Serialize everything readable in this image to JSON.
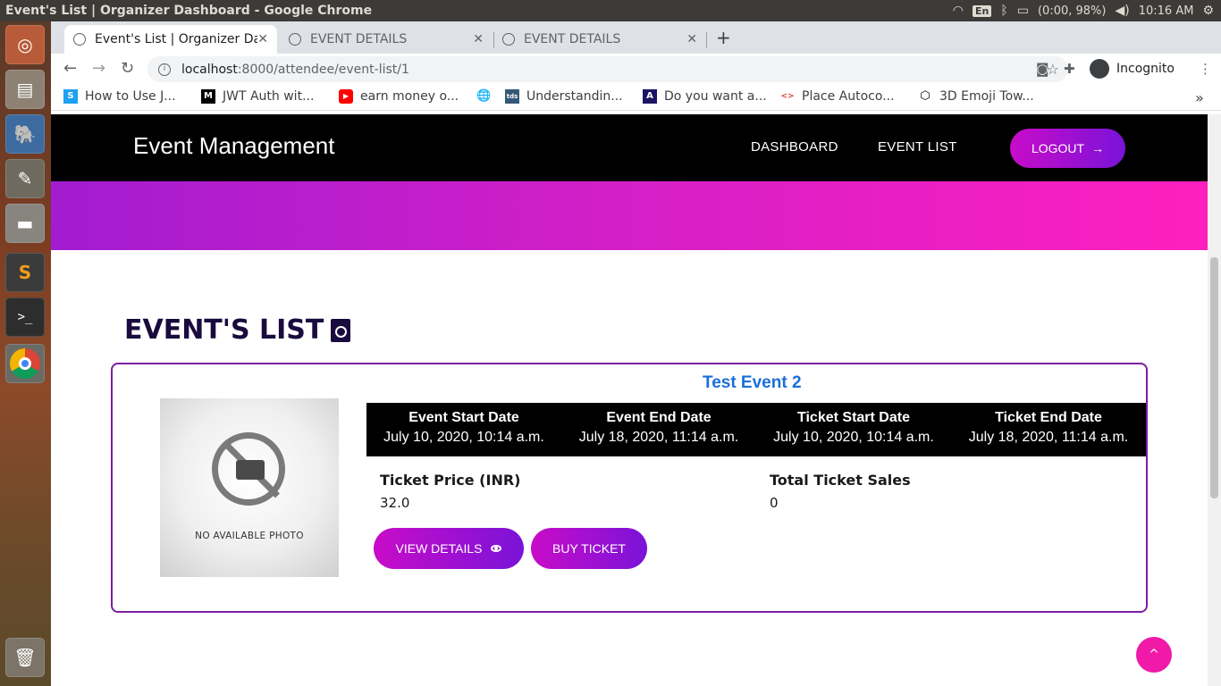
{
  "os": {
    "window_title": "Event's List | Organizer Dashboard - Google Chrome",
    "keyboard": "En",
    "battery": "(0:00, 98%)",
    "clock": "10:16 AM"
  },
  "browser": {
    "tabs": [
      {
        "label": "Event's List | Organizer Da",
        "close": "✕"
      },
      {
        "label": "EVENT DETAILS",
        "close": "✕"
      },
      {
        "label": "EVENT DETAILS",
        "close": "✕"
      }
    ],
    "new_tab": "+",
    "url_host": "localhost",
    "url_path": ":8000/attendee/event-list/1",
    "incognito_label": "Incognito",
    "bookmarks": [
      {
        "label": "How to Use J...",
        "icon": "S"
      },
      {
        "label": "JWT Auth wit...",
        "icon": "M"
      },
      {
        "label": "earn money o...",
        "icon": "▶"
      },
      {
        "label": "",
        "icon": "🌐"
      },
      {
        "label": "Understandin...",
        "icon": "tds"
      },
      {
        "label": "Do you want a...",
        "icon": "A"
      },
      {
        "label": "Place Autoco...",
        "icon": "<>"
      },
      {
        "label": "3D Emoji Tow...",
        "icon": "⬡"
      }
    ],
    "bookmarks_more": "»"
  },
  "site": {
    "brand": "Event Management",
    "nav": {
      "dashboard": "DASHBOARD",
      "event_list": "EVENT LIST"
    },
    "logout": "LOGOUT",
    "logout_arrow": "→"
  },
  "main": {
    "title": "EVENT'S LIST",
    "events": [
      {
        "name": "Test Event 2",
        "photo_text": "NO AVAILABLE PHOTO",
        "dates": [
          {
            "header": "Event Start Date",
            "value": "July 10, 2020, 10:14 a.m."
          },
          {
            "header": "Event End Date",
            "value": "July 18, 2020, 11:14 a.m."
          },
          {
            "header": "Ticket Start Date",
            "value": "July 10, 2020, 10:14 a.m."
          },
          {
            "header": "Ticket End Date",
            "value": "July 18, 2020, 11:14 a.m."
          }
        ],
        "ticket_price_label": "Ticket Price (INR)",
        "ticket_price": "32.0",
        "sales_label": "Total Ticket Sales",
        "sales": "0",
        "view_details": "VIEW DETAILS",
        "buy_ticket": "BUY TICKET"
      }
    ],
    "back_to_top": "^"
  },
  "colors": {
    "accent_gradient_start": "#c80cc8",
    "accent_gradient_end": "#7a13d8",
    "event_name": "#1a6fd9",
    "card_border": "#7b1fa2",
    "back_to_top": "#f019a8"
  }
}
